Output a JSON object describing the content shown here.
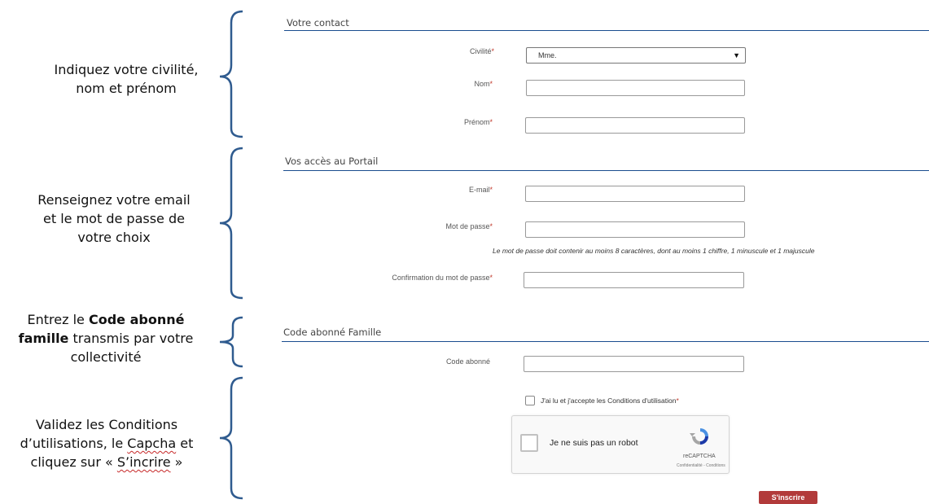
{
  "annotations": {
    "contact": {
      "line1": "Indiquez votre civilité,",
      "line2": "nom et prénom"
    },
    "access": {
      "line1": "Renseignez votre email",
      "line2": "et le mot de passe de",
      "line3": "votre choix"
    },
    "code": {
      "prefix": "Entrez le ",
      "bold1": "Code abonné",
      "bold2": "famille",
      "suffix": " transmis par votre",
      "line3": "collectivité"
    },
    "validate": {
      "line1": "Validez les Conditions",
      "line2": "d’utilisations, le ",
      "capcha": "Capcha",
      "line2_end": " et",
      "line3_start": "cliquez sur « ",
      "sinscrire": "S’incrire",
      "line3_end": " »"
    }
  },
  "sections": {
    "contact": "Votre contact",
    "access": "Vos accès au Portail",
    "code": "Code abonné Famille"
  },
  "form": {
    "civilite_label": "Civilité",
    "civilite_value": "Mme.",
    "nom_label": "Nom",
    "prenom_label": "Prénom",
    "email_label": "E-mail",
    "password_label": "Mot de passe",
    "password_hint": "Le mot de passe doit contenir au moins 8 caractères, dont au moins 1 chiffre, 1 minuscule et 1 majuscule",
    "confirm_label": "Confirmation du mot de passe",
    "code_label": "Code abonné",
    "required_mark": "*",
    "terms_label": "J'ai lu et j'accepte les Conditions d'utilisation"
  },
  "captcha": {
    "label": "Je ne suis pas un robot",
    "brand": "reCAPTCHA",
    "links": "Confidentialité - Conditions"
  },
  "submit_label": "S'inscrire",
  "colors": {
    "rule": "#1a4d8f",
    "button": "#b23a3a",
    "required": "#c0392b"
  }
}
